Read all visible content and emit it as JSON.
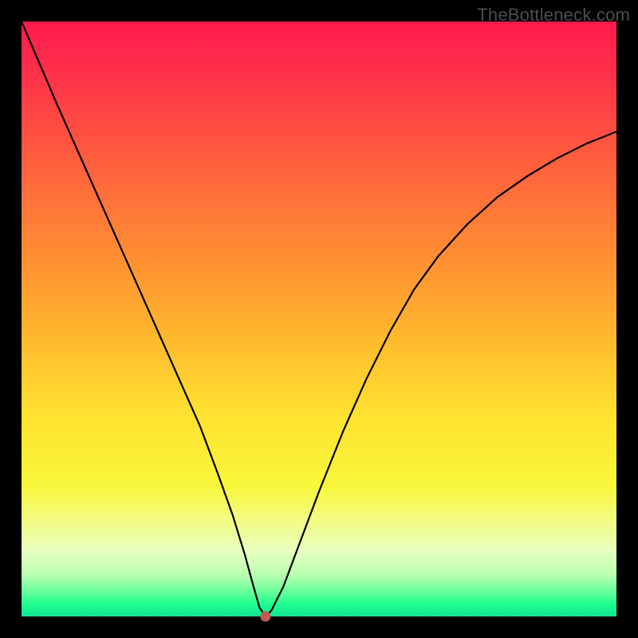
{
  "watermark": "TheBottleneck.com",
  "chart_data": {
    "type": "line",
    "title": "",
    "xlabel": "",
    "ylabel": "",
    "xlim": [
      0,
      100
    ],
    "ylim": [
      0,
      100
    ],
    "background_gradient": {
      "top": "#ff1a4d",
      "bottom": "#12e292",
      "meaning": "red=high bottleneck, green=low bottleneck"
    },
    "series": [
      {
        "name": "bottleneck-curve",
        "color": "#000000",
        "x": [
          0.0,
          3.0,
          6.0,
          10.0,
          14.0,
          18.0,
          22.0,
          26.0,
          30.0,
          33.0,
          35.5,
          37.5,
          39.0,
          40.0,
          41.0,
          42.0,
          44.0,
          47.0,
          50.0,
          54.0,
          58.0,
          62.0,
          66.0,
          70.0,
          75.0,
          80.0,
          85.0,
          90.0,
          95.0,
          100.0
        ],
        "values": [
          100.0,
          93.0,
          86.0,
          77.0,
          68.0,
          59.0,
          50.0,
          41.0,
          32.0,
          24.0,
          17.0,
          10.5,
          5.0,
          1.5,
          0.0,
          1.0,
          5.0,
          13.0,
          21.0,
          31.0,
          40.0,
          48.0,
          55.0,
          60.5,
          66.0,
          70.5,
          74.0,
          77.0,
          79.5,
          81.5
        ]
      }
    ],
    "marker": {
      "name": "optimum-point",
      "x": 41.0,
      "y": 0.0,
      "color": "#c05a56",
      "radius_px": 6
    }
  }
}
